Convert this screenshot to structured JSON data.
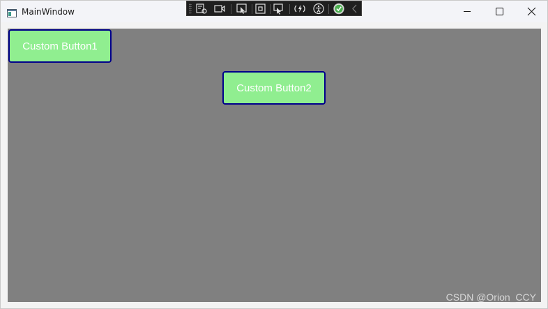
{
  "window": {
    "title": "MainWindow",
    "icon": "app-window-icon",
    "controls": {
      "minimize_icon": "minimize-icon",
      "maximize_icon": "maximize-icon",
      "close_icon": "close-icon"
    }
  },
  "debug_toolbar": {
    "tools": [
      {
        "name": "live-visual-tree-icon"
      },
      {
        "name": "record-video-icon"
      },
      {
        "name": "select-element-icon"
      },
      {
        "name": "display-layout-adorners-icon"
      },
      {
        "name": "track-focused-element-icon"
      },
      {
        "name": "hot-reload-icon"
      },
      {
        "name": "accessibility-icon"
      },
      {
        "name": "binding-failures-check-icon"
      },
      {
        "name": "collapse-toolbar-chevron-icon"
      }
    ]
  },
  "content": {
    "background_color": "#808080",
    "buttons": [
      {
        "label": "Custom Button1",
        "background": "#90ee90",
        "border": "#00008b"
      },
      {
        "label": "Custom Button2",
        "background": "#90ee90",
        "border": "#00008b"
      }
    ]
  },
  "watermark": "CSDN @Orion_CCY"
}
